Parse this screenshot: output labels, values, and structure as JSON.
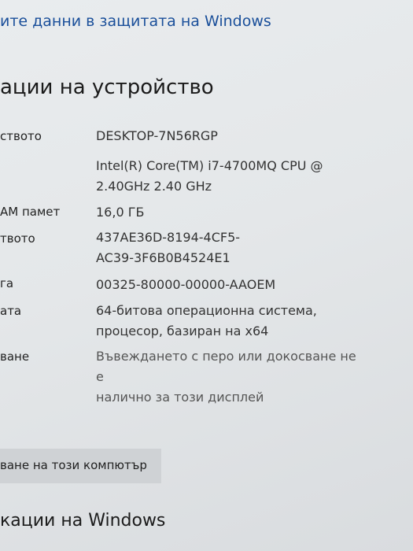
{
  "header": {
    "security_link": "ите данни в защитата на Windows",
    "section_title": "ации на устройство"
  },
  "specs": [
    {
      "label": "ството",
      "value": "DESKTOP-7N56RGP"
    },
    {
      "label": "",
      "value": "Intel(R) Core(TM) i7-4700MQ CPU @\n2.40GHz   2.40 GHz"
    },
    {
      "label": "АМ памет",
      "value": "16,0 ГБ"
    },
    {
      "label": "твото",
      "value": "437AE36D-8194-4CF5-\nAC39-3F6B0B4524E1"
    },
    {
      "label": "га",
      "value": "00325-80000-00000-AAOEM"
    },
    {
      "label": "ата",
      "value": "64-битова операционна система,\nпроцесор, базиран на x64"
    },
    {
      "label": "ване",
      "value": "Въвеждането с перо или докосване не е\nналично за този дисплей"
    }
  ],
  "actions": {
    "rename_button": "ване на този компютър"
  },
  "footer": {
    "windows_specs_title": "кации на Windows"
  }
}
